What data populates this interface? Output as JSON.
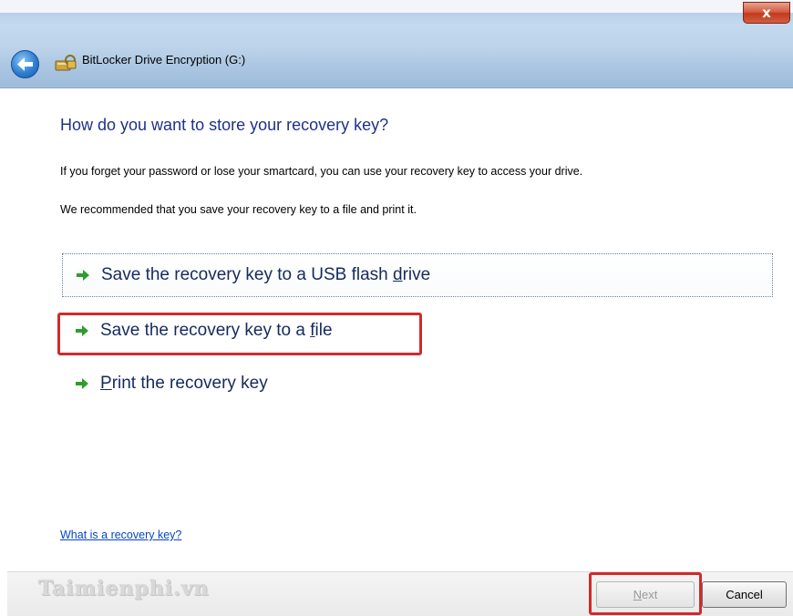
{
  "window": {
    "title": "BitLocker Drive Encryption (G:)",
    "close_label": "x"
  },
  "main": {
    "heading": "How do you want to store your recovery key?",
    "description_1": "If you forget your password or lose your smartcard, you can use your recovery key to access your drive.",
    "description_2": "We recommended that you save your recovery key to a file and print it.",
    "options": [
      {
        "label_pre": "Save the recovery key to a USB flash ",
        "access_key": "d",
        "label_post": "rive"
      },
      {
        "label_pre": "Save the recovery key to a ",
        "access_key": "f",
        "label_post": "ile"
      },
      {
        "label_pre": "",
        "access_key": "P",
        "label_post": "rint the recovery key"
      }
    ],
    "help_link": "What is a recovery key?"
  },
  "footer": {
    "watermark": "Taimienphi.vn",
    "next_access_key": "N",
    "next_rest": "ext",
    "cancel_label": "Cancel"
  },
  "colors": {
    "accent_heading": "#1e3287",
    "highlight_box": "#d22a2a",
    "link": "#0645c8",
    "arrow_green": "#2e9d2e"
  }
}
